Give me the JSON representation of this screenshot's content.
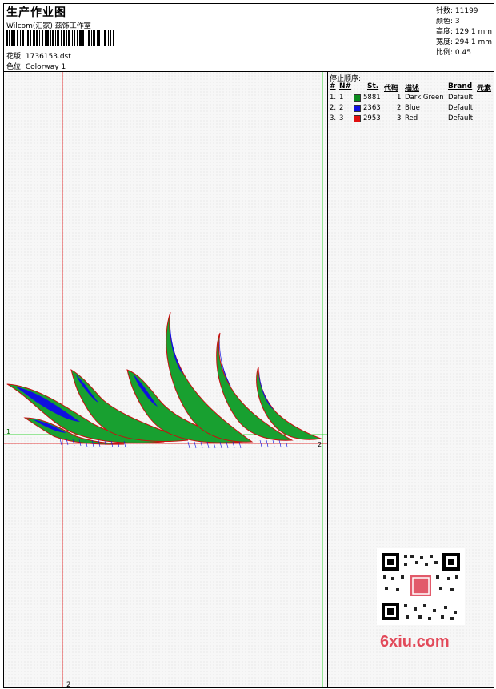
{
  "header": {
    "title": "生产作业图",
    "company": "Wilcom(汇家) 兹饰工作室",
    "design_label": "花版: 1736153.dst",
    "colorway_label": "色位: Colorway 1"
  },
  "stats": {
    "stitches": "针数: 11199",
    "colors": "颜色: 3",
    "height": "高度: 129.1 mm",
    "width": "宽度: 294.1 mm",
    "scale": "比例: 0.45"
  },
  "stop_sequence": {
    "title": "停止顺序:",
    "headers": {
      "index": "#",
      "n": "N#",
      "st": "St.",
      "code": "代码",
      "desc": "描述",
      "brand": "Brand",
      "elem": "元素"
    },
    "rows": [
      {
        "index": "1.",
        "n": "1",
        "color": "#0c8a1e",
        "st": "5881",
        "code": "1",
        "desc": "Dark Green",
        "brand": "Default"
      },
      {
        "index": "2.",
        "n": "2",
        "color": "#1010e0",
        "st": "2363",
        "code": "2",
        "desc": "Blue",
        "brand": "Default"
      },
      {
        "index": "3.",
        "n": "3",
        "color": "#e01010",
        "st": "2953",
        "code": "3",
        "desc": "Red",
        "brand": "Default"
      }
    ]
  },
  "guides": {
    "label_1": "1",
    "label_2": "2",
    "label_bottom": "2",
    "green_color": "#00cc00",
    "red_color": "#e00000"
  },
  "watermark": {
    "site": "6xiu.com"
  }
}
